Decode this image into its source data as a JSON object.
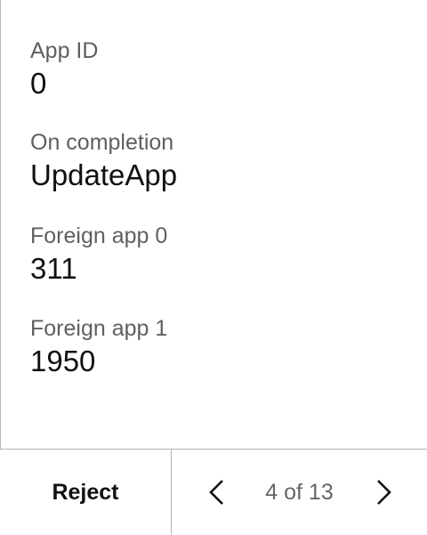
{
  "fields": [
    {
      "label": "App ID",
      "value": "0"
    },
    {
      "label": "On completion",
      "value": "UpdateApp"
    },
    {
      "label": "Foreign app 0",
      "value": "311"
    },
    {
      "label": "Foreign app 1",
      "value": "1950"
    }
  ],
  "footer": {
    "reject_label": "Reject",
    "page_indicator": "4 of 13",
    "prev_icon": "chevron-left-icon",
    "next_icon": "chevron-right-icon"
  }
}
